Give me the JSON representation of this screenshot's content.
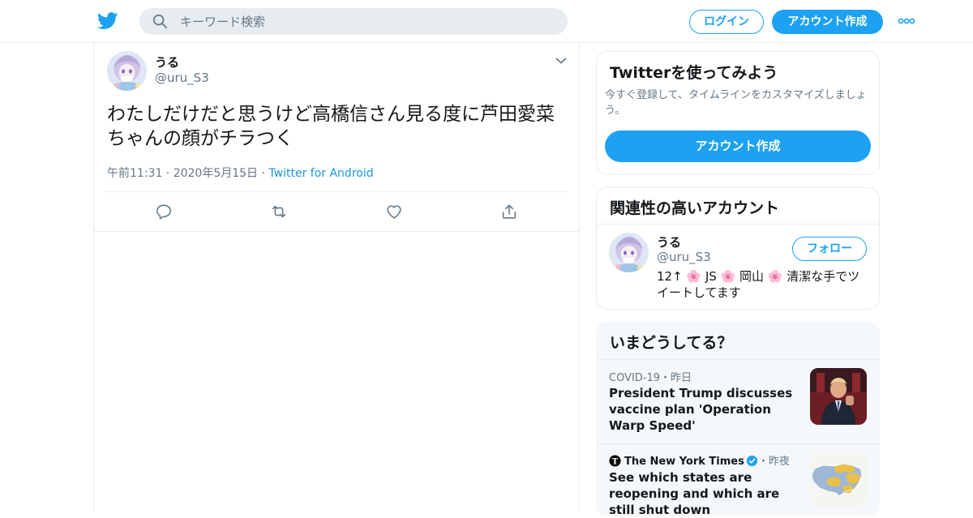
{
  "header": {
    "search_placeholder": "キーワード検索",
    "login_label": "ログイン",
    "signup_label": "アカウント作成"
  },
  "tweet": {
    "author_name": "うる",
    "author_handle": "@uru_S3",
    "text": "わたしだけだと思うけど高橋信さん見る度に芦田愛菜ちゃんの顔がチラつく",
    "time": "午前11:31 · 2020年5月15日 · ",
    "source": "Twitter for Android"
  },
  "signup_card": {
    "title": "Twitterを使ってみよう",
    "description": "今すぐ登録して、タイムラインをカスタマイズしましょう。",
    "button_label": "アカウント作成"
  },
  "related_card": {
    "title": "関連性の高いアカウント",
    "account": {
      "name": "うる",
      "handle": "@uru_S3",
      "follow_label": "フォロー",
      "bio": "12↑ 🌸 JS 🌸 岡山 🌸 清潔な手でツイートしてます"
    }
  },
  "trends_card": {
    "title": "いまどうしてる？",
    "items": [
      {
        "meta": "COVID-19・昨日",
        "headline": "President Trump discusses vaccine plan 'Operation Warp Speed'"
      },
      {
        "source": "The New York Times",
        "meta_suffix": "・昨夜",
        "headline": "See which states are reopening and which are still shut down"
      }
    ]
  },
  "colors": {
    "accent": "#1da1f2",
    "link": "#1b95e0",
    "secondary_text": "#657786",
    "border": "#e6ecf0"
  },
  "icons": [
    "twitter-logo-icon",
    "search-icon",
    "more-icon",
    "caret-down-icon",
    "reply-icon",
    "retweet-icon",
    "like-icon",
    "share-icon",
    "nyt-logo-icon",
    "verified-icon"
  ]
}
